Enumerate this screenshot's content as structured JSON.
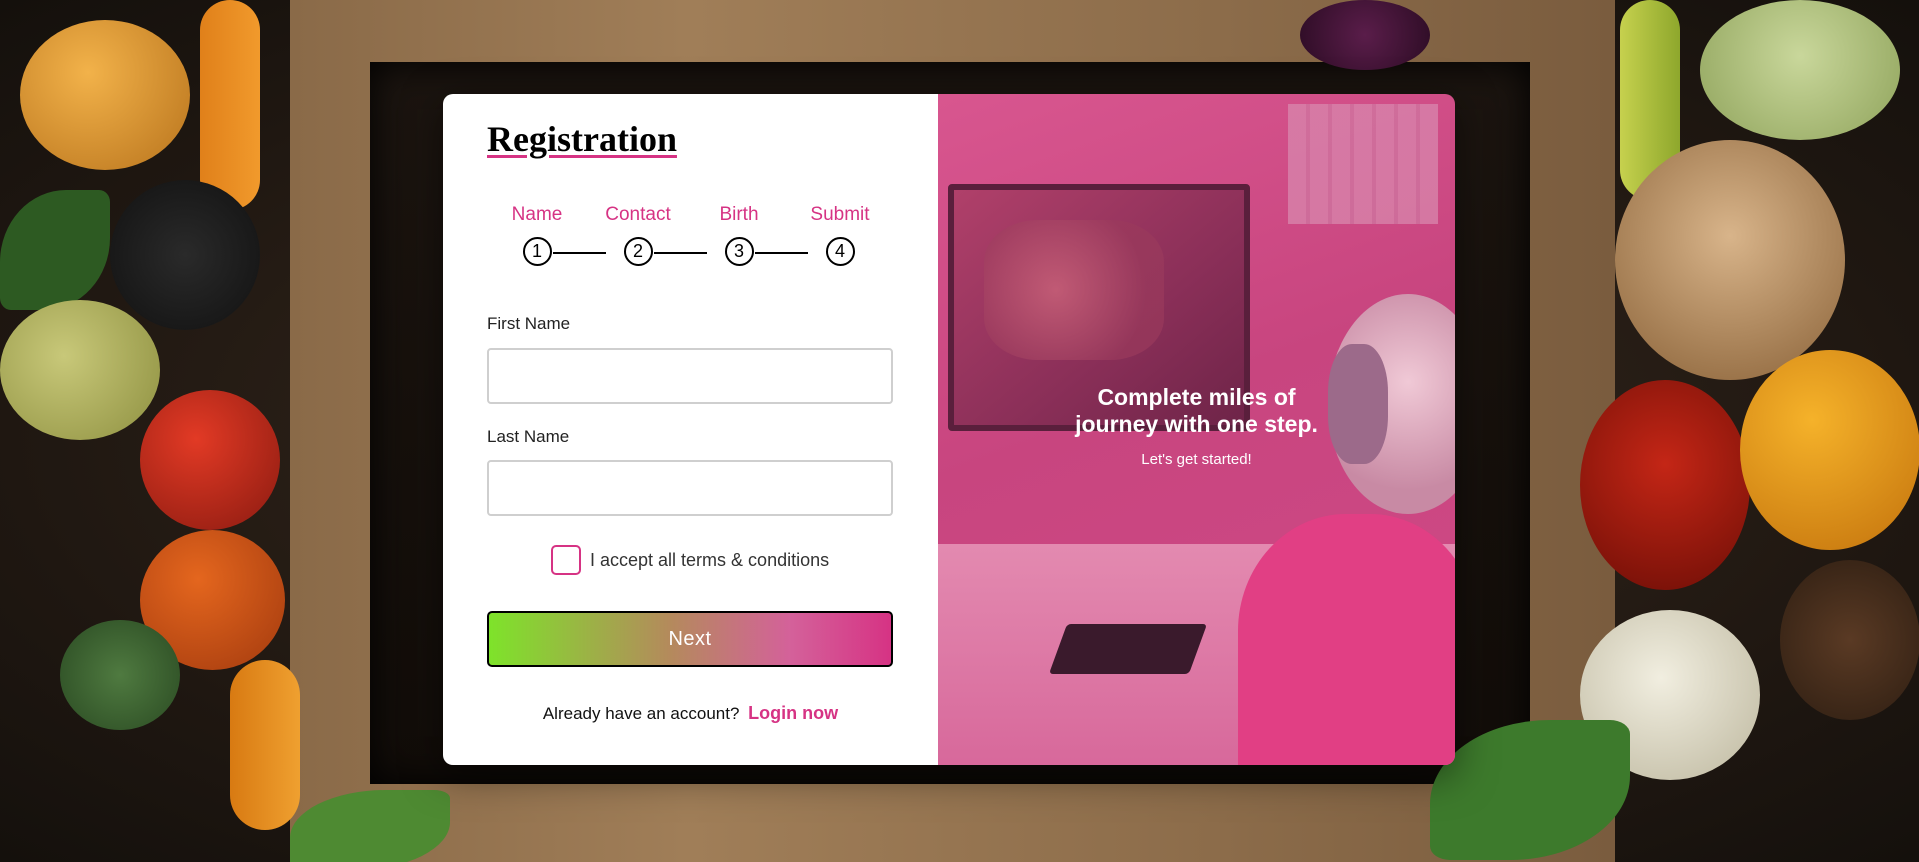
{
  "form": {
    "title": "Registration",
    "steps": [
      {
        "label": "Name",
        "number": "1"
      },
      {
        "label": "Contact",
        "number": "2"
      },
      {
        "label": "Birth",
        "number": "3"
      },
      {
        "label": "Submit",
        "number": "4"
      }
    ],
    "fields": [
      {
        "label": "First Name",
        "value": "",
        "placeholder": ""
      },
      {
        "label": "Last Name",
        "value": "",
        "placeholder": ""
      }
    ],
    "terms_label": "I accept all terms & conditions",
    "terms_checked": false,
    "next_label": "Next",
    "login_prompt": "Already have an account?",
    "login_link": "Login now"
  },
  "promo": {
    "headline_line1": "Complete miles of",
    "headline_line2": "journey with one step.",
    "subline": "Let's get started!"
  },
  "colors": {
    "accent": "#d63384",
    "button_gradient_start": "#7ee32a",
    "button_gradient_end": "#d63384",
    "overlay": "#d04a87"
  }
}
